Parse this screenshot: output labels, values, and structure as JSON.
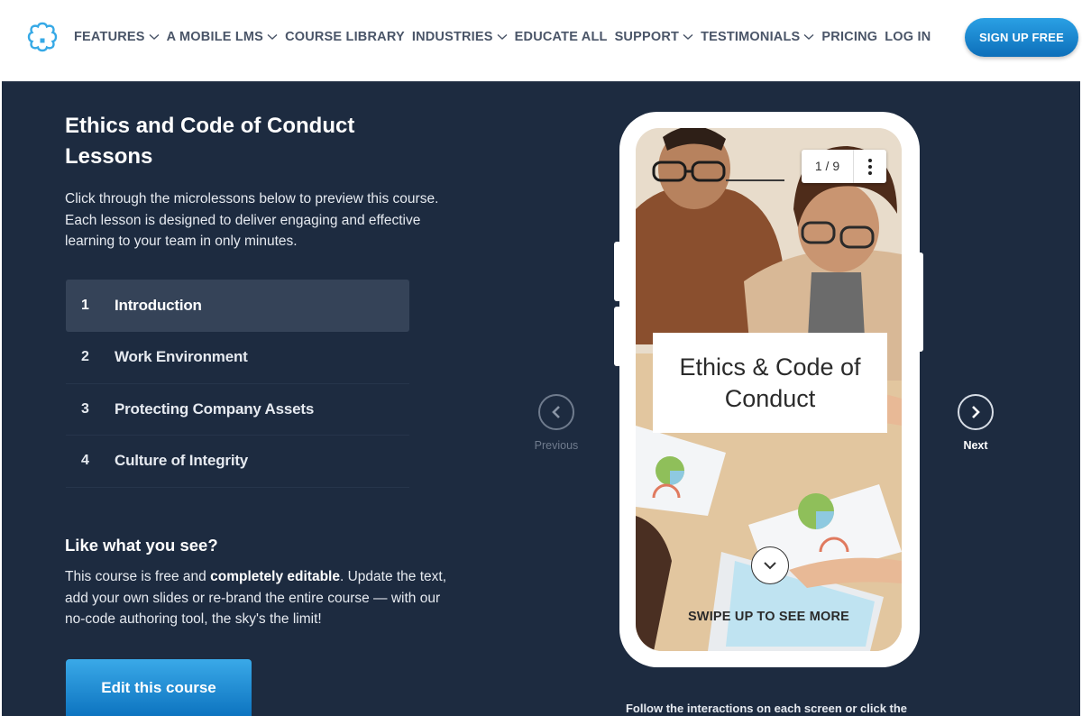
{
  "header": {
    "logo": "flower-logo-icon",
    "nav": [
      {
        "label": "FEATURES",
        "dropdown": true
      },
      {
        "label": "A MOBILE LMS",
        "dropdown": true
      },
      {
        "label": "COURSE LIBRARY",
        "dropdown": false
      },
      {
        "label": "INDUSTRIES",
        "dropdown": true
      },
      {
        "label": "EDUCATE ALL",
        "dropdown": false
      },
      {
        "label": "SUPPORT",
        "dropdown": true
      },
      {
        "label": "TESTIMONIALS",
        "dropdown": true
      },
      {
        "label": "PRICING",
        "dropdown": false
      },
      {
        "label": "LOG IN",
        "dropdown": false
      }
    ],
    "signup_label": "SIGN UP FREE"
  },
  "course": {
    "title": "Ethics and Code of Conduct Lessons",
    "intro": "Click through the microlessons below to preview this course. Each lesson is designed to deliver engaging and effective learning to your team in only minutes.",
    "lessons": [
      {
        "num": "1",
        "label": "Introduction",
        "active": true
      },
      {
        "num": "2",
        "label": "Work Environment",
        "active": false
      },
      {
        "num": "3",
        "label": "Protecting Company Assets",
        "active": false
      },
      {
        "num": "4",
        "label": "Culture of Integrity",
        "active": false
      }
    ]
  },
  "cta": {
    "title": "Like what you see?",
    "text_before": "This course is free and ",
    "text_bold": "completely editable",
    "text_after": ". Update the text, add your own slides or re-brand the entire course — with our no-code authoring tool, the sky's the limit!",
    "button_label": "Edit this course"
  },
  "preview": {
    "counter": "1 / 9",
    "slide_title": "Ethics & Code of Conduct",
    "swipe_text": "SWIPE UP TO SEE MORE",
    "previous_label": "Previous",
    "next_label": "Next",
    "follow_text": "Follow the interactions on each screen or click the"
  },
  "colors": {
    "panel_bg": "#1d2b40",
    "accent_blue": "#1a8ad6",
    "active_lesson_bg": "#354358"
  }
}
